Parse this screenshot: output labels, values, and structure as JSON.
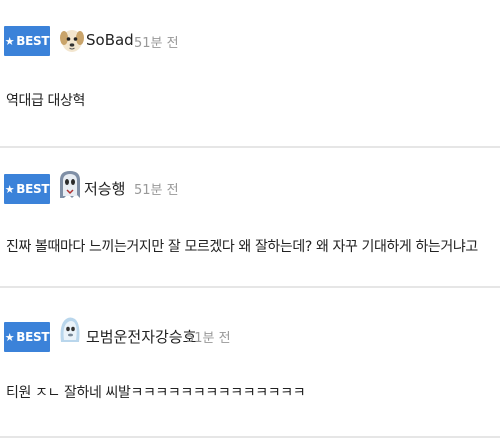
{
  "colors": {
    "best_badge": "#3b82d9",
    "nickname": "#222222",
    "time": "#999999",
    "divider": "#e6e6e6"
  },
  "comments": [
    {
      "badge": "BEST",
      "badge_icon": "star-icon",
      "avatar_icon": "puppy-avatar-icon",
      "nickname": "SoBad",
      "time": "51분 전",
      "text": "역대급 대상혁"
    },
    {
      "badge": "BEST",
      "badge_icon": "star-icon",
      "avatar_icon": "ghost-avatar-icon",
      "nickname": "저승행",
      "time": "51분 전",
      "text": "진짜 볼때마다 느끼는거지만 잘 모르겠다 왜 잘하는데? 왜 자꾸 기대하게 하는거냐고"
    },
    {
      "badge": "BEST",
      "badge_icon": "star-icon",
      "avatar_icon": "mask-avatar-icon",
      "nickname": "모범운전자강승호",
      "time": "51분 전",
      "text": "티원 ㅈㄴ 잘하네 씨발ㅋㅋㅋㅋㅋㅋㅋㅋㅋㅋㅋㅋㅋㅋ"
    }
  ]
}
